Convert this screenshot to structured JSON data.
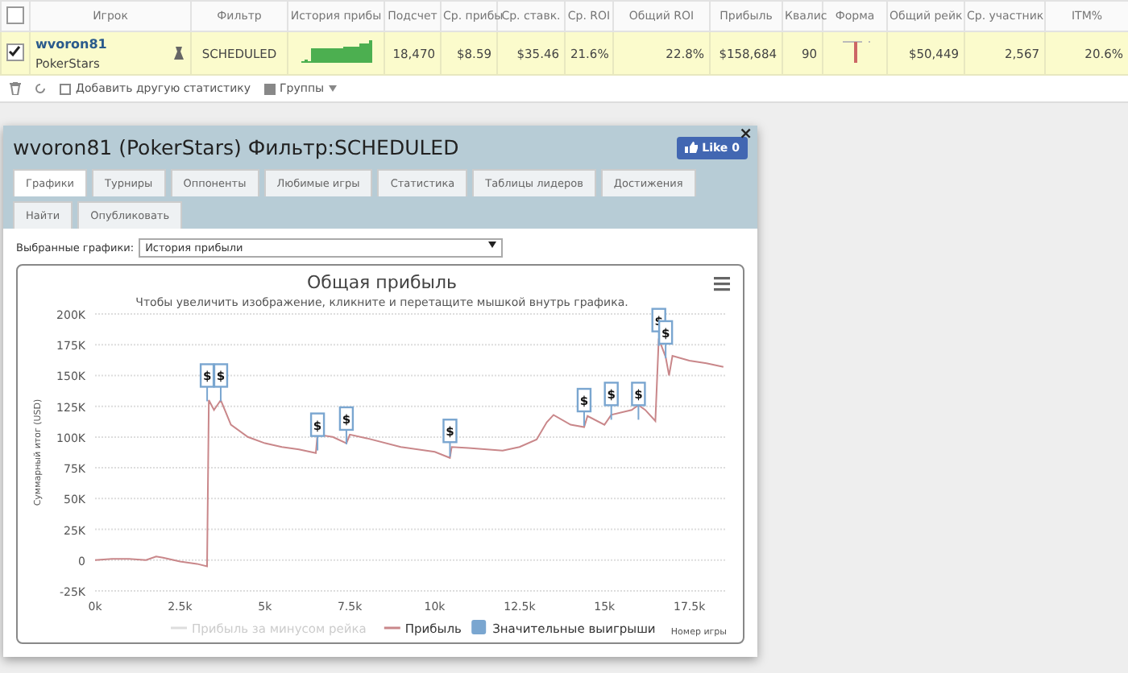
{
  "stats_table": {
    "columns": [
      "Игрок",
      "Фильтр",
      "История прибы",
      "Подсчет",
      "Ср. прибы",
      "Ср. ставк.",
      "Ср. ROI",
      "Общий ROI",
      "Прибыль",
      "Квалис",
      "Форма",
      "Общий рейк",
      "Ср. участник",
      "ITM%"
    ],
    "all_checked": false,
    "rows": [
      {
        "checked": true,
        "player": "wvoron81",
        "site": "PokerStars",
        "filter": "SCHEDULED",
        "count": "18,470",
        "avg_profit": "$8.59",
        "avg_stake": "$35.46",
        "avg_roi": "21.6%",
        "total_roi": "22.8%",
        "profit": "$158,684",
        "column_10": "90",
        "total_rake": "$50,449",
        "avg_entrants": "2,567",
        "itm": "20.6%"
      }
    ],
    "toolbar": {
      "add_stat": "Добавить другую статистику",
      "groups": "Группы"
    }
  },
  "dialog": {
    "title": "wvoron81 (PokerStars) Фильтр:SCHEDULED",
    "like": "Like 0",
    "close": "×",
    "tabs": [
      {
        "label": "Графики",
        "selected": true
      },
      {
        "label": "Турниры",
        "selected": false
      },
      {
        "label": "Оппоненты",
        "selected": false
      },
      {
        "label": "Любимые игры",
        "selected": false
      },
      {
        "label": "Статистика",
        "selected": false
      },
      {
        "label": "Таблицы лидеров",
        "selected": false
      },
      {
        "label": "Достижения",
        "selected": false
      },
      {
        "label": "Найти",
        "selected": false
      },
      {
        "label": "Опубликовать",
        "selected": false
      }
    ],
    "graph_select": {
      "label": "Выбранные графики:",
      "value": "История прибыли"
    },
    "chart": {
      "chart_data": {
        "type": "line",
        "title": "Общая прибыль",
        "subtitle": "Чтобы увеличить изображение, кликните и перетащите мышкой внутрь графика.",
        "xlabel": "Номер игры",
        "ylabel": "Суммарный итог (USD)",
        "x": [
          0,
          500,
          1000,
          1500,
          1800,
          2000,
          2500,
          3000,
          3300,
          3350,
          3500,
          3700,
          4000,
          4500,
          5000,
          5500,
          6000,
          6500,
          6550,
          7000,
          7400,
          7500,
          8000,
          9000,
          10000,
          10450,
          10500,
          11000,
          12000,
          12500,
          13000,
          13300,
          13500,
          14000,
          14400,
          14500,
          15000,
          15200,
          15800,
          16000,
          16200,
          16500,
          16600,
          16800,
          16900,
          17000,
          17500,
          18000,
          18500
        ],
        "grid": true,
        "legend": "bottom",
        "series": [
          {
            "name": "Прибыль",
            "color": "#c9878a",
            "values": [
              0,
              1000,
              1000,
              0,
              3000,
              2000,
              -1000,
              -3000,
              -5000,
              130000,
              122000,
              130000,
              110000,
              100000,
              95000,
              92000,
              90000,
              87000,
              102000,
              100000,
              95000,
              102000,
              99000,
              92000,
              88000,
              83000,
              92000,
              91000,
              89000,
              92000,
              98000,
              112000,
              118000,
              110000,
              108000,
              117000,
              110000,
              118000,
              122000,
              126000,
              122000,
              113000,
              180000,
              165000,
              150000,
              166000,
              162000,
              160000,
              157000
            ]
          },
          {
            "name": "Значительные выигрыши",
            "type": "scatter",
            "color": "#7aa6d0",
            "values": [
              null,
              null,
              null,
              null,
              null,
              null,
              null,
              null,
              150000,
              null,
              null,
              150000,
              null,
              null,
              null,
              null,
              null,
              null,
              110000,
              null,
              115000,
              null,
              null,
              null,
              null,
              105000,
              null,
              null,
              null,
              null,
              null,
              null,
              null,
              null,
              130000,
              null,
              null,
              135000,
              null,
              135000,
              null,
              null,
              195000,
              185000,
              null,
              null,
              null,
              null,
              null
            ]
          }
        ],
        "xlim": [
          0,
          18600
        ],
        "ylim": [
          -25000,
          200000
        ],
        "xticks": [
          {
            "value": 0,
            "label": "0k"
          },
          {
            "value": 2500,
            "label": "2.5k"
          },
          {
            "value": 5000,
            "label": "5k"
          },
          {
            "value": 7500,
            "label": "7.5k"
          },
          {
            "value": 10000,
            "label": "10k"
          },
          {
            "value": 12500,
            "label": "12.5k"
          },
          {
            "value": 15000,
            "label": "15k"
          },
          {
            "value": 17500,
            "label": "17.5k"
          }
        ],
        "yticks": [
          {
            "value": -25000,
            "label": "-25K"
          },
          {
            "value": 0,
            "label": "0"
          },
          {
            "value": 25000,
            "label": "25K"
          },
          {
            "value": 50000,
            "label": "50K"
          },
          {
            "value": 75000,
            "label": "75K"
          },
          {
            "value": 100000,
            "label": "100K"
          },
          {
            "value": 125000,
            "label": "125K"
          },
          {
            "value": 150000,
            "label": "150K"
          },
          {
            "value": 175000,
            "label": "175K"
          },
          {
            "value": 200000,
            "label": "200K"
          }
        ]
      },
      "flags": [
        {
          "text": "$"
        },
        {
          "text": "$"
        },
        {
          "text": "$"
        },
        {
          "text": "$"
        },
        {
          "text": "$"
        },
        {
          "text": "$"
        },
        {
          "text": "$"
        },
        {
          "text": "$"
        },
        {
          "text": "$"
        },
        {
          "text": "$"
        }
      ],
      "hidden_legend": [
        {
          "label": "Прибыль за минусом рейка",
          "visible": false
        }
      ]
    }
  }
}
